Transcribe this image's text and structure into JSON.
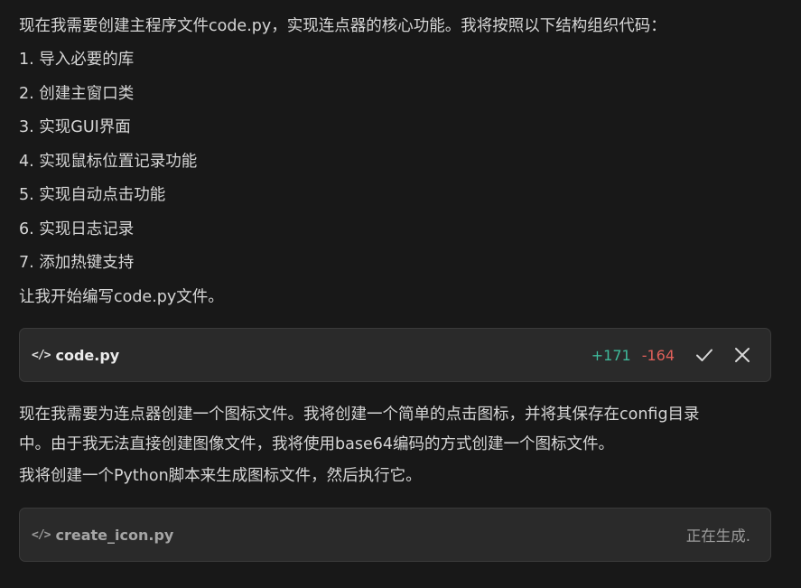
{
  "intro": "现在我需要创建主程序文件code.py，实现连点器的核心功能。我将按照以下结构组织代码：",
  "steps": [
    "1. 导入必要的库",
    "2. 创建主窗口类",
    "3. 实现GUI界面",
    "4. 实现鼠标位置记录功能",
    "5. 实现自动点击功能",
    "6. 实现日志记录",
    "7. 添加热键支持"
  ],
  "start_line": "让我开始编写code.py文件。",
  "card1": {
    "glyph": "</>",
    "filename": "code.py",
    "added": "+171",
    "removed": "-164",
    "accept_icon": "check-icon",
    "reject_icon": "close-icon"
  },
  "para2_line1": "现在我需要为连点器创建一个图标文件。我将创建一个简单的点击图标，并将其保存在config目录",
  "para2_line2": "中。由于我无法直接创建图像文件，我将使用base64编码的方式创建一个图标文件。",
  "para3": "我将创建一个Python脚本来生成图标文件，然后执行它。",
  "card2": {
    "glyph": "</>",
    "filename": "create_icon.py",
    "status": "正在生成."
  },
  "colors": {
    "background": "#181818",
    "card": "#2a2a2a",
    "added": "#3fb99a",
    "removed": "#e0605a"
  }
}
